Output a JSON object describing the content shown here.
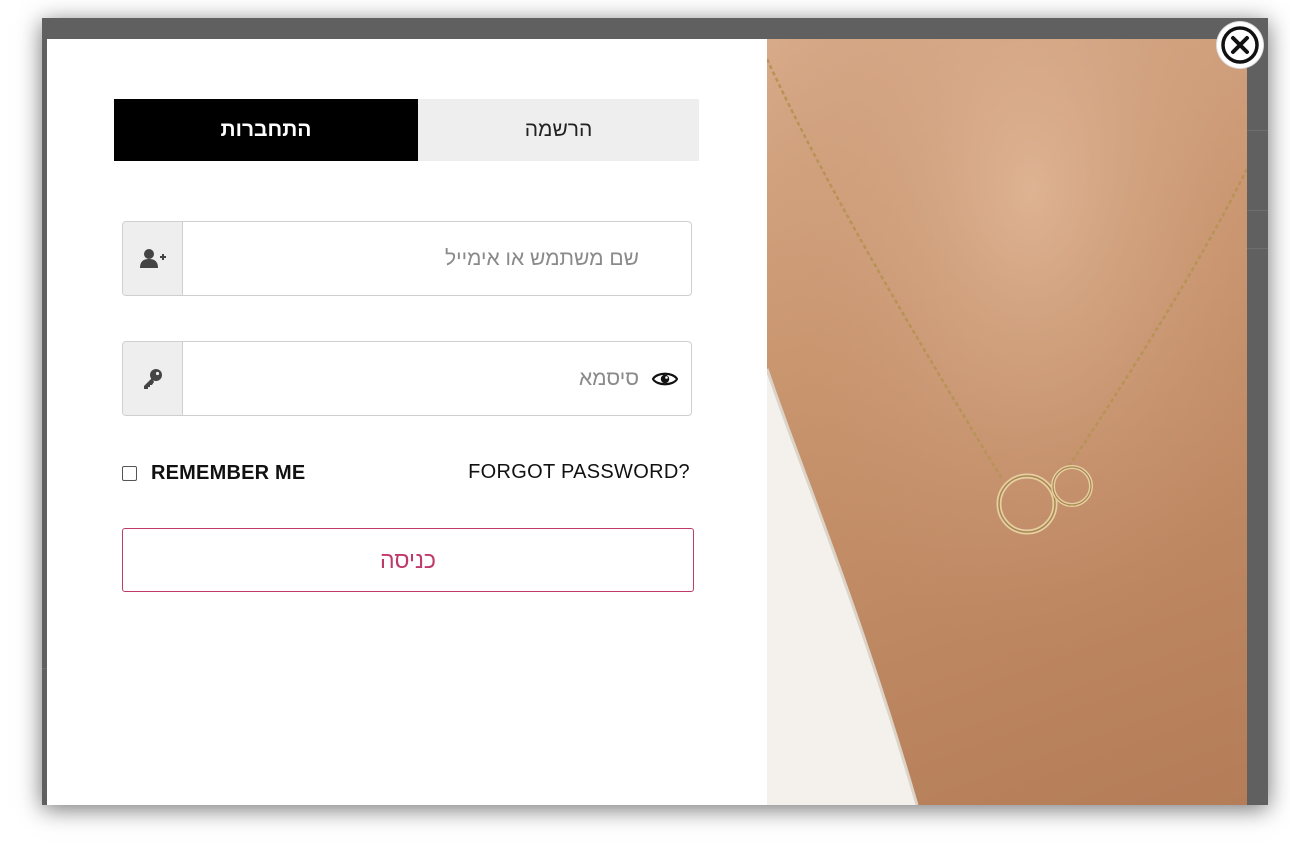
{
  "modal": {
    "tabs": {
      "login_label": "התחברות",
      "register_label": "הרשמה",
      "active": "login"
    },
    "username_field": {
      "placeholder": "שם משתמש או אימייל",
      "value": "",
      "icon": "user-plus-icon"
    },
    "password_field": {
      "placeholder": "סיסמא",
      "value": "",
      "icon": "key-icon",
      "toggle_icon": "eye-icon"
    },
    "remember_me": {
      "label": "REMEMBER ME",
      "checked": false
    },
    "forgot_password_label": "FORGOT PASSWORD?",
    "submit_label": "כניסה",
    "close_icon": "close-circle-icon",
    "image": "necklace-photo"
  },
  "colors": {
    "tab_active_bg": "#000000",
    "tab_inactive_bg": "#eeeeee",
    "accent": "#c0396b",
    "overlay": "#5a5a5a"
  }
}
